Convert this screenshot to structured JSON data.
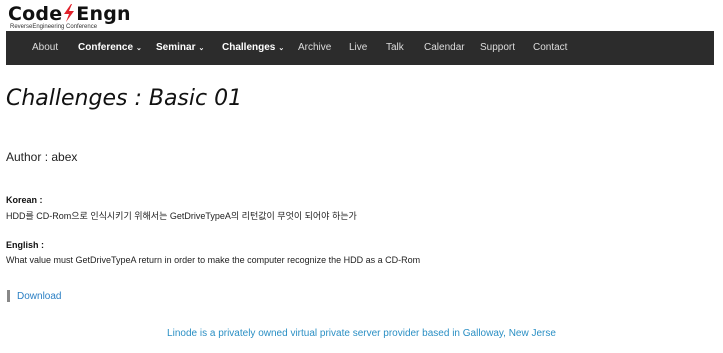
{
  "brand": {
    "logo_left": "Code",
    "logo_right": "Engn",
    "subtitle": "ReverseEngineering Conference",
    "accent": "#e0202a"
  },
  "nav": {
    "items": [
      {
        "label": "About",
        "dropdown": false
      },
      {
        "label": "Conference",
        "dropdown": true
      },
      {
        "label": "Seminar",
        "dropdown": true
      },
      {
        "label": "Challenges",
        "dropdown": true
      },
      {
        "label": "Archive",
        "dropdown": false
      },
      {
        "label": "Live",
        "dropdown": false
      },
      {
        "label": "Talk",
        "dropdown": false
      },
      {
        "label": "Calendar",
        "dropdown": false
      },
      {
        "label": "Support",
        "dropdown": false
      },
      {
        "label": "Contact",
        "dropdown": false
      }
    ]
  },
  "page": {
    "title": "Challenges : Basic 01",
    "author": "Author : abex",
    "korean_label": "Korean :",
    "korean_text": "HDD를 CD-Rom으로 인식시키기 위해서는 GetDriveTypeA의 리턴값이 무엇이 되어야 하는가",
    "english_label": "English :",
    "english_text": "What value must GetDriveTypeA return in order to make the computer recognize the HDD as a CD-Rom",
    "download_label": "Download"
  },
  "footer": {
    "text": "Linode is a privately owned virtual private server provider based in Galloway, New Jerse"
  },
  "colors": {
    "navbar_bg": "#2c2c2c",
    "link": "#2a7fc4"
  }
}
